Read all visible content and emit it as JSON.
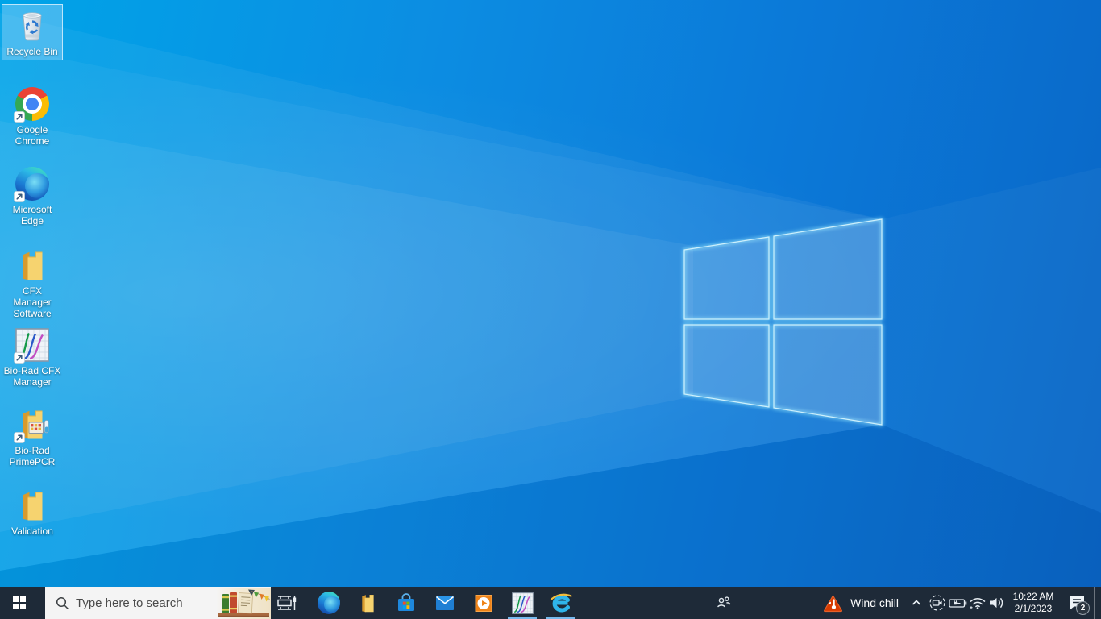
{
  "desktop": {
    "icons": [
      {
        "label": "Recycle Bin",
        "selected": true,
        "shortcut": false
      },
      {
        "label": "Google Chrome",
        "selected": false,
        "shortcut": true
      },
      {
        "label": "Microsoft Edge",
        "selected": false,
        "shortcut": true
      },
      {
        "label": "CFX Manager Software",
        "selected": false,
        "shortcut": false
      },
      {
        "label": "Bio-Rad CFX Manager",
        "selected": false,
        "shortcut": true
      },
      {
        "label": "Bio-Rad PrimePCR",
        "selected": false,
        "shortcut": true
      },
      {
        "label": "Validation",
        "selected": false,
        "shortcut": false
      }
    ]
  },
  "taskbar": {
    "search": {
      "placeholder": "Type here to search"
    },
    "apps": [
      {
        "name": "task-view",
        "running": false
      },
      {
        "name": "microsoft-edge",
        "running": false
      },
      {
        "name": "file-explorer",
        "running": false
      },
      {
        "name": "microsoft-store",
        "running": false
      },
      {
        "name": "mail",
        "running": false
      },
      {
        "name": "movies-tv",
        "running": false
      },
      {
        "name": "bio-rad-cfx-manager",
        "running": true
      },
      {
        "name": "internet-explorer",
        "running": true
      }
    ],
    "weather": {
      "label": "Wind chill",
      "alert_color": "#d83b01"
    },
    "clock": {
      "time": "10:22 AM",
      "date": "2/1/2023"
    },
    "notifications": {
      "count": "2"
    }
  },
  "colors": {
    "taskbar_background": "#1e2a38",
    "wallpaper_top_left": "#00a4e8",
    "wallpaper_right": "#0a66c6",
    "running_indicator": "#76b9ed",
    "selection_fill": "rgba(170,220,252,0.38)"
  }
}
